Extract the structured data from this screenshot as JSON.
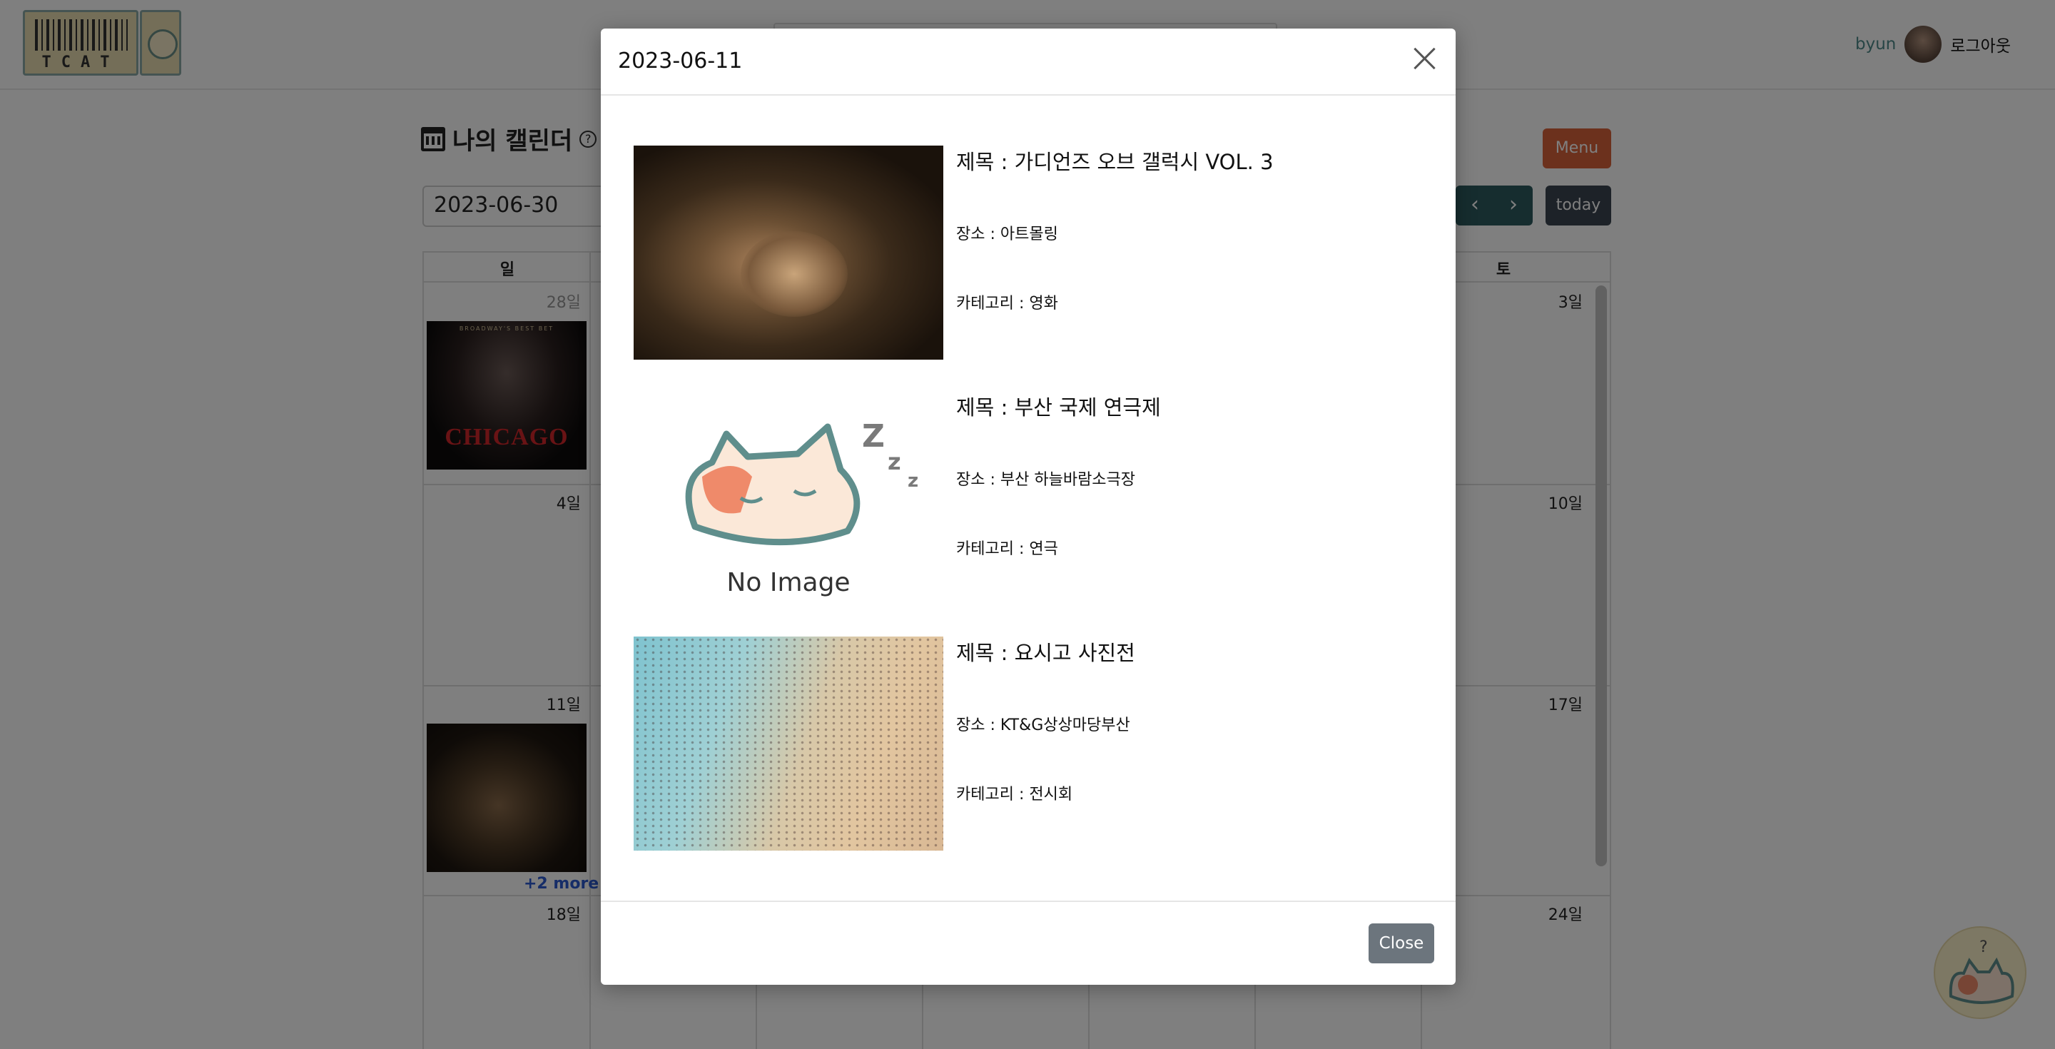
{
  "header": {
    "user_name": "byun",
    "logout_label": "로그아웃",
    "logo_text": "TCAT"
  },
  "calendar": {
    "title": "나의 캘린더",
    "menu_label": "Menu",
    "date_value": "2023-06-30",
    "prev_icon": "‹",
    "next_icon": "›",
    "today_label": "today",
    "weekdays": {
      "sun": "일",
      "sat": "토"
    },
    "days": {
      "d28": "28일",
      "d3": "3일",
      "d4": "4일",
      "d10": "10일",
      "d11": "11일",
      "d17": "17일",
      "d18": "18일",
      "d24": "24일"
    },
    "chicago_top": "BROADWAY'S BEST BET",
    "chicago_title": "CHICAGO",
    "more_label": "+2 more"
  },
  "modal": {
    "title": "2023-06-11",
    "close_label": "Close",
    "events": [
      {
        "title": "제목 : 가디언즈 오브 갤럭시 VOL. 3",
        "place": "장소 : 아트몰링",
        "category": "카테고리 : 영화"
      },
      {
        "title": "제목 : 부산 국제 연극제",
        "place": "장소 : 부산 하늘바람소극장",
        "category": "카테고리 : 연극",
        "image_placeholder": "No Image"
      },
      {
        "title": "제목 : 요시고 사진전",
        "place": "장소 : KT&G상상마당부산",
        "category": "카테고리 : 전시회"
      }
    ]
  },
  "colors": {
    "accent_teal": "#2c5b5f",
    "menu_orange": "#d9623a",
    "close_gray": "#6c757d",
    "more_blue": "#2c5bd1"
  }
}
